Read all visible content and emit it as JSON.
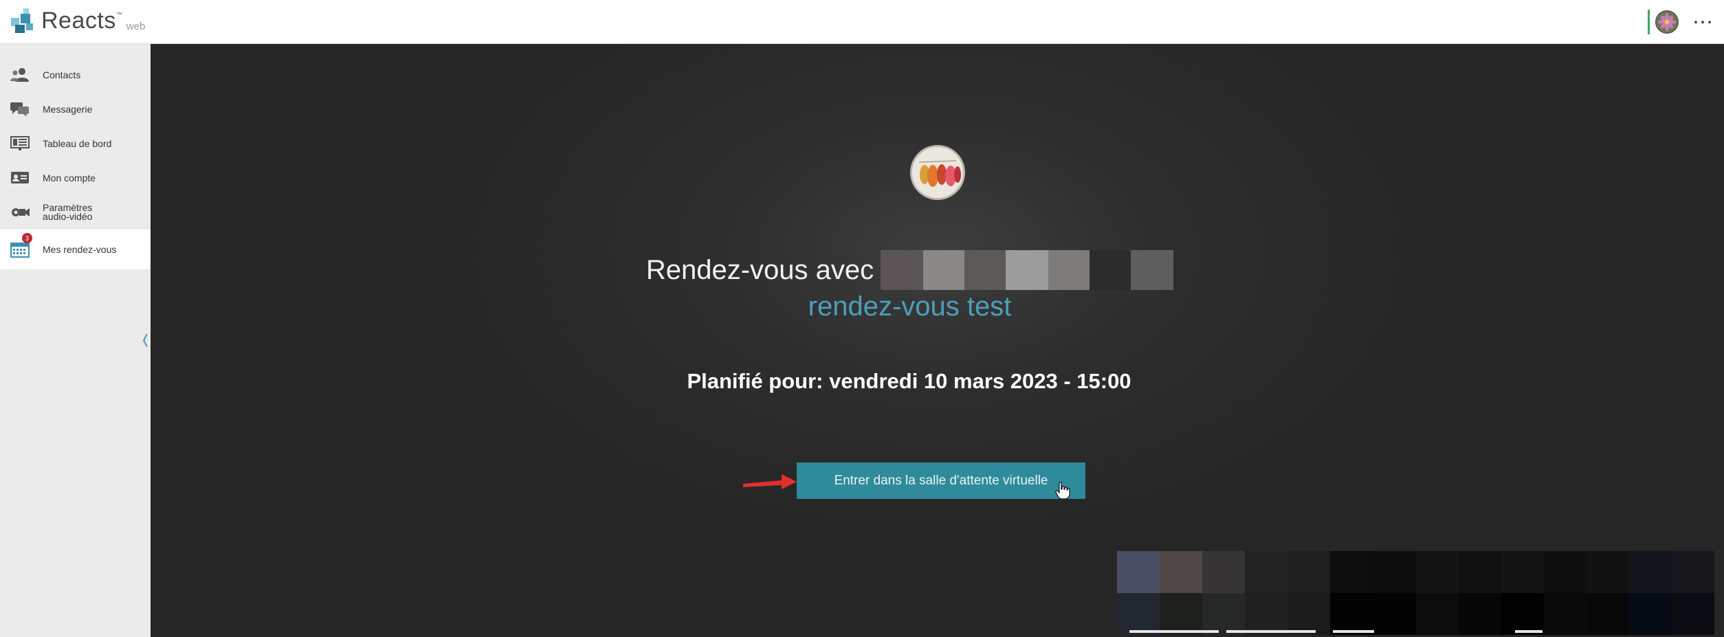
{
  "header": {
    "brand_name": "Reacts",
    "brand_tm": "™",
    "brand_sub": "web",
    "more_menu": "⋯"
  },
  "sidebar": {
    "items": [
      {
        "label": "Contacts",
        "icon": "contacts-icon"
      },
      {
        "label": "Messagerie",
        "icon": "chat-icon"
      },
      {
        "label": "Tableau de bord",
        "icon": "dashboard-icon"
      },
      {
        "label": "Mon compte",
        "icon": "id-card-icon"
      },
      {
        "label": "Paramètres audio-vidéo",
        "icon": "camera-settings-icon"
      },
      {
        "label": "Mes rendez-vous",
        "icon": "calendar-icon",
        "badge": "3",
        "active": true
      }
    ],
    "collapse_glyph": "❬"
  },
  "main": {
    "title_prefix": "Rendez-vous avec",
    "subtitle": "rendez-vous test",
    "schedule": "Planifié pour: vendredi 10 mars 2023 - 15:00",
    "enter_button": "Entrer dans la salle d'attente virtuelle"
  },
  "colors": {
    "accent": "#2f8a9b",
    "subtitle": "#4c9fbb",
    "badge": "#c0282d",
    "arrow": "#e0302b",
    "sidebar_bg": "#ebebeb",
    "main_bg": "#2e2e2e"
  }
}
